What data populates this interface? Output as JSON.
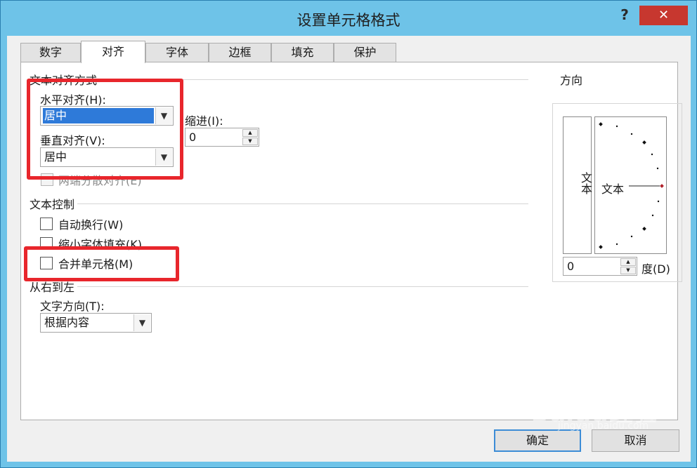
{
  "window": {
    "title": "设置单元格格式",
    "help": "?",
    "close": "✕"
  },
  "tabs": [
    {
      "label": "数字"
    },
    {
      "label": "对齐"
    },
    {
      "label": "字体"
    },
    {
      "label": "边框"
    },
    {
      "label": "填充"
    },
    {
      "label": "保护"
    }
  ],
  "active_tab": "对齐",
  "text_alignment": {
    "group_label": "文本对齐方式",
    "horizontal_label": "水平对齐(H):",
    "horizontal_value": "居中",
    "vertical_label": "垂直对齐(V):",
    "vertical_value": "居中",
    "indent_label": "缩进(I):",
    "indent_value": "0",
    "justify_distributed_label": "两端分散对齐(E)"
  },
  "text_control": {
    "group_label": "文本控制",
    "wrap_text": {
      "label": "自动换行(W)",
      "checked": false
    },
    "shrink_to_fit": {
      "label": "缩小字体填充(K)",
      "checked": false
    },
    "merge_cells": {
      "label": "合并单元格(M)",
      "checked": false
    }
  },
  "rtl": {
    "group_label": "从右到左",
    "direction_label": "文字方向(T):",
    "direction_value": "根据内容"
  },
  "orientation": {
    "group_label": "方向",
    "vertical_text": "文本",
    "dial_text": "文本",
    "degree_value": "0",
    "degree_label": "度(D)"
  },
  "buttons": {
    "ok": "确定",
    "cancel": "取消"
  },
  "watermark": {
    "text": "Baidu经验",
    "sub": "jingyan.baidu.com"
  },
  "colors": {
    "highlight_box": "#e8262c",
    "title_bar": "#6ec3e8",
    "close_button": "#c7372f",
    "selection": "#2e7ad9"
  }
}
